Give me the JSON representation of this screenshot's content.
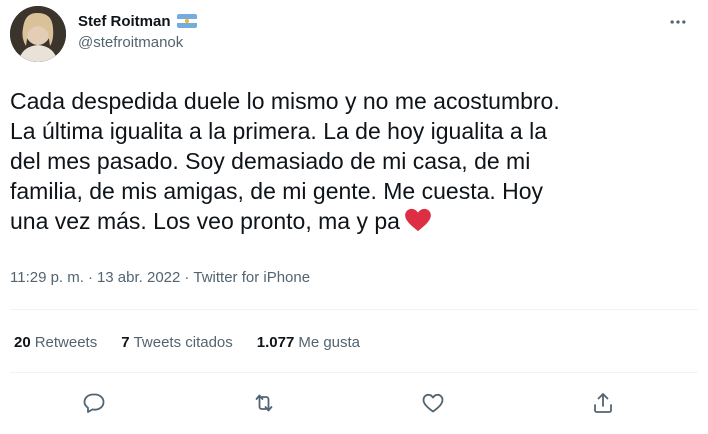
{
  "author": {
    "display_name": "Stef Roitman",
    "handle": "@stefroitmanok",
    "flag_icon": "argentina-flag-icon"
  },
  "tweet": {
    "text": "Cada despedida duele lo mismo y no me acostumbro.\nLa última igualita a la primera. La de hoy igualita a la\ndel mes pasado. Soy demasiado de mi casa, de mi\nfamilia, de mis amigas, de mi gente. Me cuesta. Hoy\nuna vez más. Los veo pronto, ma y pa",
    "emoji": "red-heart-icon",
    "heart_color": "#dd2e44"
  },
  "meta": {
    "time": "11:29 p. m.",
    "separator1": "·",
    "date": "13 abr. 2022",
    "separator2": "·",
    "source": "Twitter for iPhone"
  },
  "stats": {
    "retweets_count": "20",
    "retweets_label": "Retweets",
    "quotes_count": "7",
    "quotes_label": "Tweets citados",
    "likes_count": "1.077",
    "likes_label": "Me gusta"
  },
  "actions": [
    "reply-icon",
    "retweet-icon",
    "like-icon",
    "share-icon"
  ],
  "colors": {
    "text_primary": "#0f1419",
    "text_secondary": "#536471",
    "divider": "#eff3f4"
  }
}
